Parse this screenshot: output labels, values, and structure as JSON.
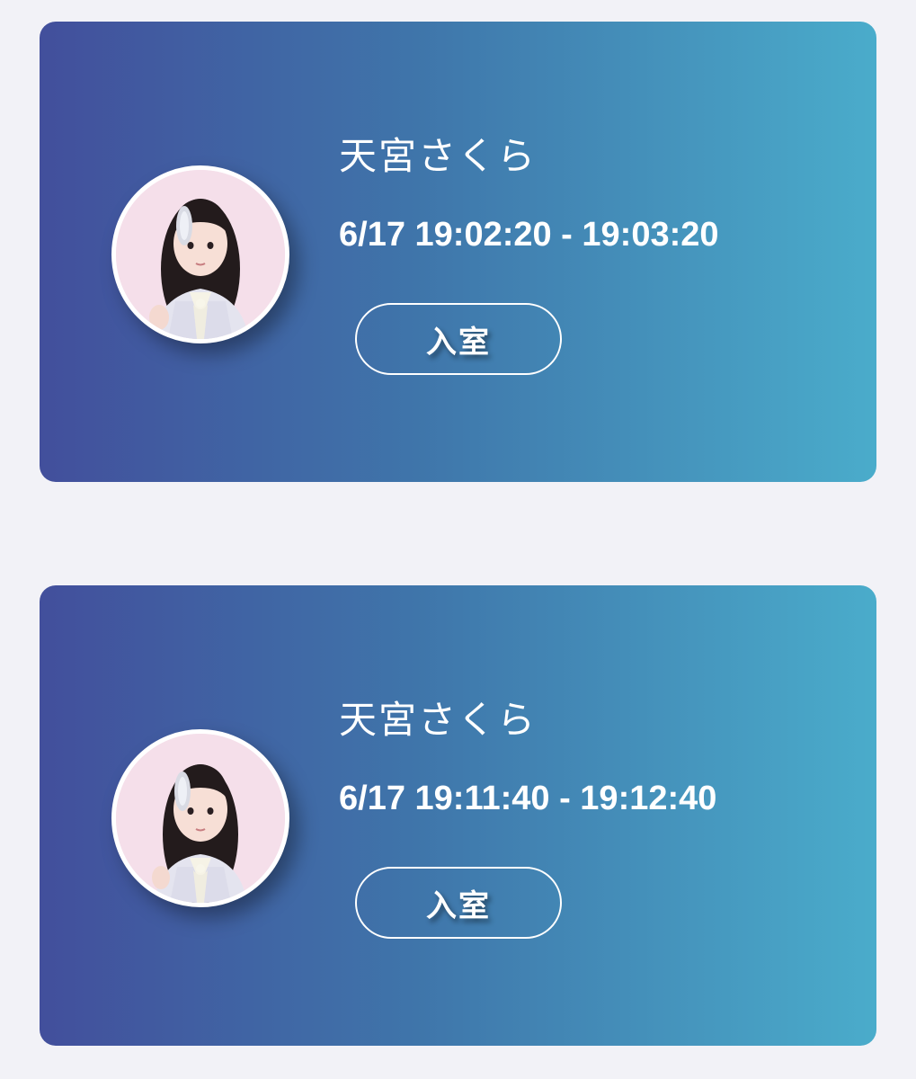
{
  "sessions": [
    {
      "name": "天宮さくら",
      "time": "6/17 19:02:20 - 19:03:20",
      "button_label": "入室"
    },
    {
      "name": "天宮さくら",
      "time": "6/17 19:11:40 - 19:12:40",
      "button_label": "入室"
    }
  ],
  "colors": {
    "page_background": "#f2f2f7",
    "card_gradient_start": "#424f9c",
    "card_gradient_end": "#4aaccb",
    "text": "#ffffff"
  }
}
